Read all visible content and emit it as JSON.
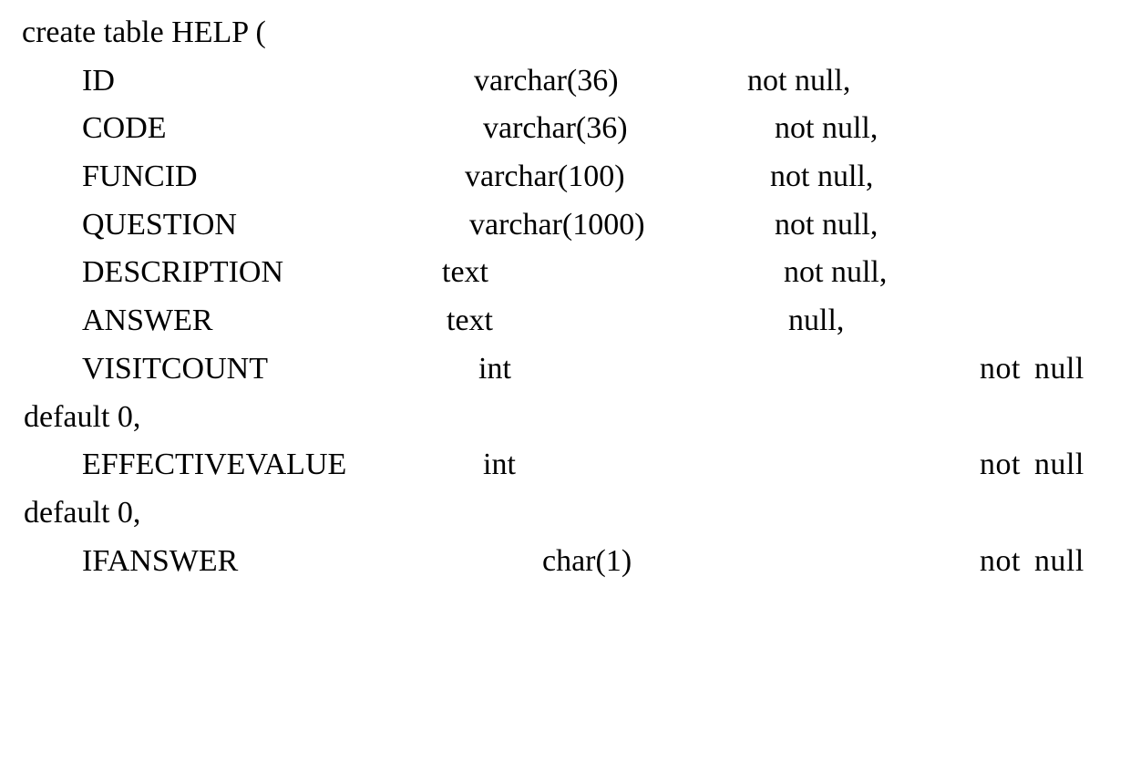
{
  "sql": {
    "statement_start": "create table HELP (",
    "rows": [
      {
        "name": "ID",
        "type": "varchar(36)",
        "constraint": "not null",
        "trailing_comma": true,
        "wrap_extra": null
      },
      {
        "name": "CODE",
        "type": "varchar(36)",
        "constraint": "not null",
        "trailing_comma": true,
        "wrap_extra": null
      },
      {
        "name": "FUNCID",
        "type": "varchar(100)",
        "constraint": "not null",
        "trailing_comma": true,
        "wrap_extra": null
      },
      {
        "name": "QUESTION",
        "type": "varchar(1000)",
        "constraint": "not null",
        "trailing_comma": true,
        "wrap_extra": null
      },
      {
        "name": "DESCRIPTION",
        "type": "text",
        "constraint": "not null",
        "trailing_comma": true,
        "wrap_extra": null
      },
      {
        "name": "ANSWER",
        "type": "text",
        "constraint": "null",
        "trailing_comma": true,
        "wrap_extra": null
      },
      {
        "name": "VISITCOUNT",
        "type": "int",
        "constraint": "not  null",
        "trailing_comma": false,
        "wrap_extra": "default 0,"
      },
      {
        "name": "EFFECTIVEVALUE",
        "type": "int",
        "constraint": "not  null",
        "trailing_comma": false,
        "wrap_extra": "default 0,"
      },
      {
        "name": "IFANSWER",
        "type": "char(1)",
        "constraint": "not  null",
        "trailing_comma": false,
        "wrap_extra": null
      }
    ]
  }
}
